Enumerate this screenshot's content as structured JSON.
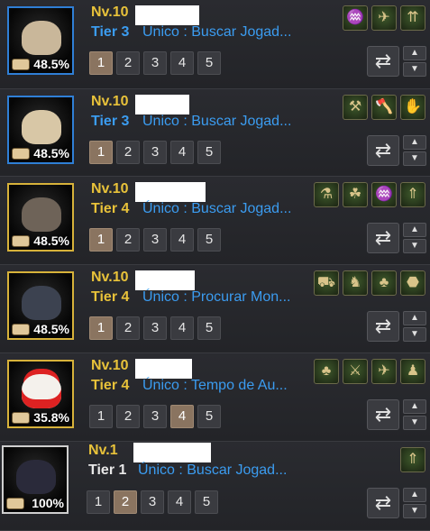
{
  "pets": [
    {
      "level": "Nv.10",
      "tier": "Tier 3",
      "talent": "Unico : Buscar Jogad...",
      "percent": "48.5%",
      "tier_color": "blue",
      "pet_icon": "dog-icon",
      "skills": [
        {
          "icon": "spring-icon",
          "glyph": "♒"
        },
        {
          "icon": "wing-icon",
          "glyph": "✈"
        },
        {
          "icon": "arrows-up-icon",
          "glyph": "⇈"
        }
      ],
      "active_page": 0
    },
    {
      "level": "Nv.10",
      "tier": "Tier 3",
      "talent": "Unico : Buscar Jogad...",
      "percent": "48.5%",
      "tier_color": "blue",
      "pet_icon": "hatchling-icon",
      "skills": [
        {
          "icon": "pickaxe-icon",
          "glyph": "⚒"
        },
        {
          "icon": "axe-icon",
          "glyph": "🪓"
        },
        {
          "icon": "hand-icon",
          "glyph": "✋"
        }
      ],
      "active_page": 0
    },
    {
      "level": "Nv.10",
      "tier": "Tier 4",
      "talent": "Único : Buscar Jogad...",
      "percent": "48.5%",
      "tier_color": "gold",
      "pet_icon": "dog-icon",
      "skills": [
        {
          "icon": "potion-icon",
          "glyph": "⚗"
        },
        {
          "icon": "hedgehog-icon",
          "glyph": "☘"
        },
        {
          "icon": "spring-icon",
          "glyph": "♒"
        },
        {
          "icon": "arrow-red-icon",
          "glyph": "⇑"
        }
      ],
      "active_page": 0
    },
    {
      "level": "Nv.10",
      "tier": "Tier 4",
      "talent": "Único : Procurar Mon...",
      "percent": "48.5%",
      "tier_color": "gold",
      "pet_icon": "crow-icon",
      "skills": [
        {
          "icon": "carriage-icon",
          "glyph": "⛟"
        },
        {
          "icon": "horse-icon",
          "glyph": "♞"
        },
        {
          "icon": "clover-icon",
          "glyph": "♣"
        },
        {
          "icon": "red-shield-icon",
          "glyph": "⬣"
        }
      ],
      "active_page": 0
    },
    {
      "level": "Nv.10",
      "tier": "Tier 4",
      "talent": "Único : Tempo de Au...",
      "percent": "35.8%",
      "tier_color": "gold",
      "pet_icon": "santa-bear-icon",
      "skills": [
        {
          "icon": "clover-icon",
          "glyph": "♣"
        },
        {
          "icon": "axe-icon",
          "glyph": "⚔"
        },
        {
          "icon": "wing-icon",
          "glyph": "✈"
        },
        {
          "icon": "red-person-icon",
          "glyph": "♟"
        }
      ],
      "active_page": 3
    },
    {
      "level": "Nv.1",
      "tier": "Tier 1",
      "talent": "Único : Buscar Jogad...",
      "percent": "100%",
      "tier_color": "white",
      "pet_icon": "wolf-icon",
      "skills": [
        {
          "icon": "arrow-up-green-icon",
          "glyph": "⇑"
        }
      ],
      "active_page": 1
    }
  ],
  "page_labels": [
    "1",
    "2",
    "3",
    "4",
    "5"
  ],
  "controls": {
    "swap_glyph": "⇄",
    "up_glyph": "▲",
    "down_glyph": "▼"
  },
  "colors": {
    "tier_blue": "#3b9cf0",
    "tier_gold": "#e8c23a",
    "active_page": "#8a7460"
  }
}
